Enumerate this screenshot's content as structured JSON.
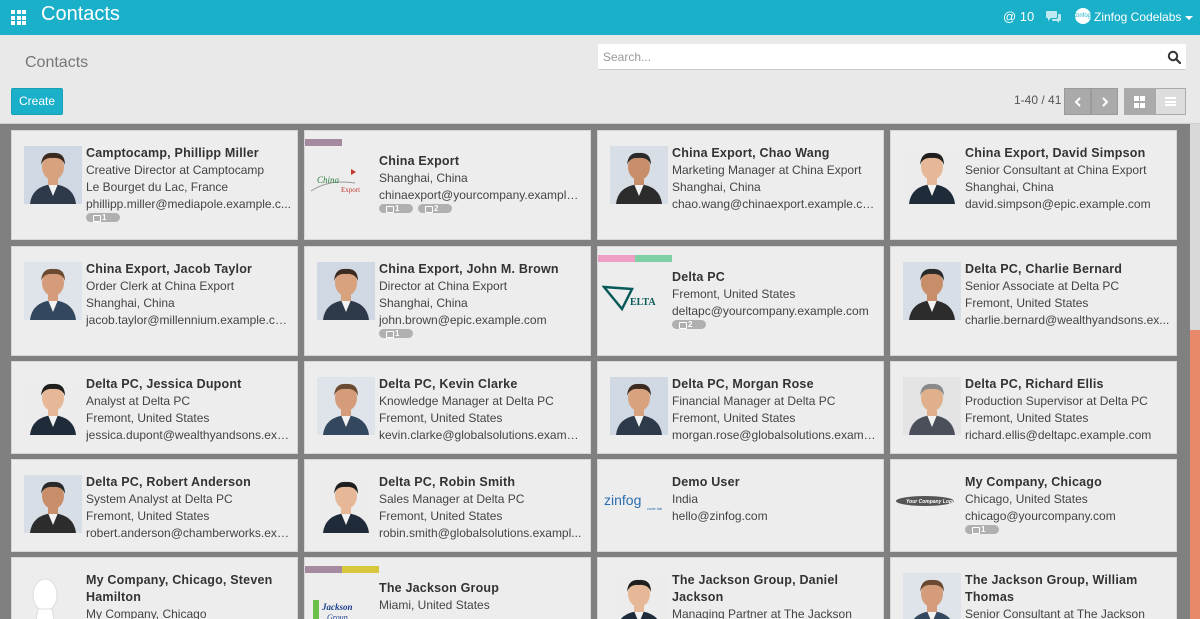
{
  "topbar": {
    "app_title": "Contacts",
    "mentions": "@ 10",
    "user_name": "Zinfog Codelabs",
    "user_avatar_text": "zinfog"
  },
  "control_panel": {
    "breadcrumb": "Contacts",
    "search_placeholder": "Search...",
    "create_label": "Create",
    "pager_value": "1-40 / 41",
    "pager_prev_icon": "chevron-left-icon",
    "pager_next_icon": "chevron-right-icon"
  },
  "colors": {
    "brand": "#1ab0c9",
    "kanban_background": "#808080",
    "card_background": "#ededed",
    "badge": "#b0b0b0",
    "scroll_thumb": "#e8896b"
  },
  "cards": [
    {
      "name": "Camptocamp, Phillipp Miller",
      "line1": "Creative Director at Camptocamp",
      "line2": "Le Bourget du Lac, France",
      "line3": "phillipp.miller@mediapole.example.c...",
      "badges": [
        "1"
      ],
      "tags": [],
      "photo": "person"
    },
    {
      "name": "China Export",
      "line1": "Shanghai, China",
      "line2": "chinaexport@yourcompany.example....",
      "line3": "",
      "badges": [
        "1",
        "2"
      ],
      "tags": [
        "#a58aa0"
      ],
      "photo": "china-export-logo"
    },
    {
      "name": "China Export, Chao Wang",
      "line1": "Marketing Manager at China Export",
      "line2": "Shanghai, China",
      "line3": "chao.wang@chinaexport.example.com",
      "badges": [],
      "tags": [],
      "photo": "person"
    },
    {
      "name": "China Export, David Simpson",
      "line1": "Senior Consultant at China Export",
      "line2": "Shanghai, China",
      "line3": "david.simpson@epic.example.com",
      "badges": [],
      "tags": [],
      "photo": "person"
    },
    {
      "name": "China Export, Jacob Taylor",
      "line1": "Order Clerk at China Export",
      "line2": "Shanghai, China",
      "line3": "jacob.taylor@millennium.example.com",
      "badges": [],
      "tags": [],
      "photo": "person"
    },
    {
      "name": "China Export, John M. Brown",
      "line1": "Director at China Export",
      "line2": "Shanghai, China",
      "line3": "john.brown@epic.example.com",
      "badges": [
        "1"
      ],
      "tags": [],
      "photo": "person"
    },
    {
      "name": "Delta PC",
      "line1": "Fremont, United States",
      "line2": "deltapc@yourcompany.example.com",
      "line3": "",
      "badges": [
        "2"
      ],
      "tags": [
        "#ef9ec6",
        "#7fd0a4"
      ],
      "photo": "delta-logo"
    },
    {
      "name": "Delta PC, Charlie Bernard",
      "line1": "Senior Associate at Delta PC",
      "line2": "Fremont, United States",
      "line3": "charlie.bernard@wealthyandsons.ex...",
      "badges": [],
      "tags": [],
      "photo": "person"
    },
    {
      "name": "Delta PC, Jessica Dupont",
      "line1": "Analyst at Delta PC",
      "line2": "Fremont, United States",
      "line3": "jessica.dupont@wealthyandsons.exa...",
      "badges": [],
      "tags": [],
      "photo": "person"
    },
    {
      "name": "Delta PC, Kevin Clarke",
      "line1": "Knowledge Manager at Delta PC",
      "line2": "Fremont, United States",
      "line3": "kevin.clarke@globalsolutions.exampl...",
      "badges": [],
      "tags": [],
      "photo": "person"
    },
    {
      "name": "Delta PC, Morgan Rose",
      "line1": "Financial Manager at Delta PC",
      "line2": "Fremont, United States",
      "line3": "morgan.rose@globalsolutions.examp...",
      "badges": [],
      "tags": [],
      "photo": "person"
    },
    {
      "name": "Delta PC, Richard Ellis",
      "line1": "Production Supervisor at Delta PC",
      "line2": "Fremont, United States",
      "line3": "richard.ellis@deltapc.example.com",
      "badges": [],
      "tags": [],
      "photo": "person"
    },
    {
      "name": "Delta PC, Robert Anderson",
      "line1": "System Analyst at Delta PC",
      "line2": "Fremont, United States",
      "line3": "robert.anderson@chamberworks.exa...",
      "badges": [],
      "tags": [],
      "photo": "person"
    },
    {
      "name": "Delta PC, Robin Smith",
      "line1": "Sales Manager at Delta PC",
      "line2": "Fremont, United States",
      "line3": "robin.smith@globalsolutions.exampl...",
      "badges": [],
      "tags": [],
      "photo": "person"
    },
    {
      "name": "Demo User",
      "line1": "India",
      "line2": "hello@zinfog.com",
      "line3": "",
      "badges": [],
      "tags": [],
      "photo": "zinfog-logo"
    },
    {
      "name": "My Company, Chicago",
      "line1": "Chicago, United States",
      "line2": "chicago@yourcompany.com",
      "line3": "",
      "badges": [
        "1"
      ],
      "tags": [],
      "photo": "your-company-logo"
    },
    {
      "name": "My Company, Chicago, Steven Hamilton",
      "line1": "My Company, Chicago",
      "line2": "",
      "line3": "",
      "badges": [],
      "tags": [],
      "photo": "placeholder-person"
    },
    {
      "name": "The Jackson Group",
      "line1": "Miami, United States",
      "line2": "",
      "line3": "",
      "badges": [],
      "tags": [
        "#a58aa0",
        "#d6c83a"
      ],
      "photo": "jackson-logo"
    },
    {
      "name": "The Jackson Group, Daniel Jackson",
      "line1": "Managing Partner at The Jackson",
      "line2": "",
      "line3": "",
      "badges": [],
      "tags": [],
      "photo": "person"
    },
    {
      "name": "The Jackson Group, William Thomas",
      "line1": "Senior Consultant at The Jackson",
      "line2": "",
      "line3": "",
      "badges": [],
      "tags": [],
      "photo": "person"
    }
  ],
  "logos": {
    "china_export": "China Export",
    "delta": "ELTA",
    "zinfog": "zinfog",
    "zinfog_tag": "code labs",
    "your_company": "Your Company Logo",
    "jackson": "Jackson Group"
  }
}
